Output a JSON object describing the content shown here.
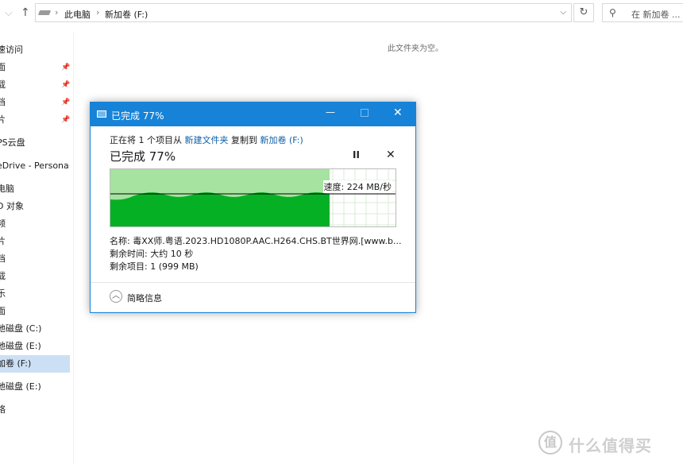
{
  "explorer": {
    "breadcrumb": [
      "此电脑",
      "新加卷 (F:)"
    ],
    "search_placeholder": "在 新加卷 ...",
    "empty_message": "此文件夹为空。",
    "sidebar_items": [
      {
        "label": "速访问",
        "pinned": false,
        "selected": false
      },
      {
        "label": "面",
        "pinned": true,
        "selected": false
      },
      {
        "label": "载",
        "pinned": true,
        "selected": false
      },
      {
        "label": "档",
        "pinned": true,
        "selected": false
      },
      {
        "label": "片",
        "pinned": true,
        "selected": false
      },
      {
        "label": "PS云盘",
        "pinned": false,
        "selected": false
      },
      {
        "label": "eDrive - Persona",
        "pinned": false,
        "selected": false
      },
      {
        "label": "电脑",
        "pinned": false,
        "selected": false
      },
      {
        "label": "D 对象",
        "pinned": false,
        "selected": false
      },
      {
        "label": "频",
        "pinned": false,
        "selected": false
      },
      {
        "label": "片",
        "pinned": false,
        "selected": false
      },
      {
        "label": "档",
        "pinned": false,
        "selected": false
      },
      {
        "label": "载",
        "pinned": false,
        "selected": false
      },
      {
        "label": "乐",
        "pinned": false,
        "selected": false
      },
      {
        "label": "面",
        "pinned": false,
        "selected": false
      },
      {
        "label": "地磁盘 (C:)",
        "pinned": false,
        "selected": false
      },
      {
        "label": "地磁盘 (E:)",
        "pinned": false,
        "selected": false
      },
      {
        "label": "加卷 (F:)",
        "pinned": false,
        "selected": true
      },
      {
        "label": "地磁盘 (E:)",
        "pinned": false,
        "selected": false
      },
      {
        "label": "络",
        "pinned": false,
        "selected": false
      }
    ]
  },
  "dialog": {
    "title": "已完成 77%",
    "copy_prefix": "正在将 1 个项目从",
    "source_link": "新建文件夹",
    "copy_mid": "复制到",
    "dest_link": "新加卷 (F:)",
    "progress_title": "已完成 77%",
    "progress_fraction": 0.77,
    "speed": "速度: 224 MB/秒",
    "name_line": "名称: 毒XX师.粤语.2023.HD1080P.AAC.H264.CHS.BT世界网.[www.b...",
    "time_line": "剩余时间: 大约 10 秒",
    "items_line": "剩余项目: 1 (999 MB)",
    "less_details": "简略信息"
  },
  "watermark": {
    "text": "什么值得买",
    "icon_glyph": "值"
  },
  "colors": {
    "accent": "#1683d8",
    "progress_light": "#a6e3a0",
    "progress_dark": "#06b025"
  }
}
